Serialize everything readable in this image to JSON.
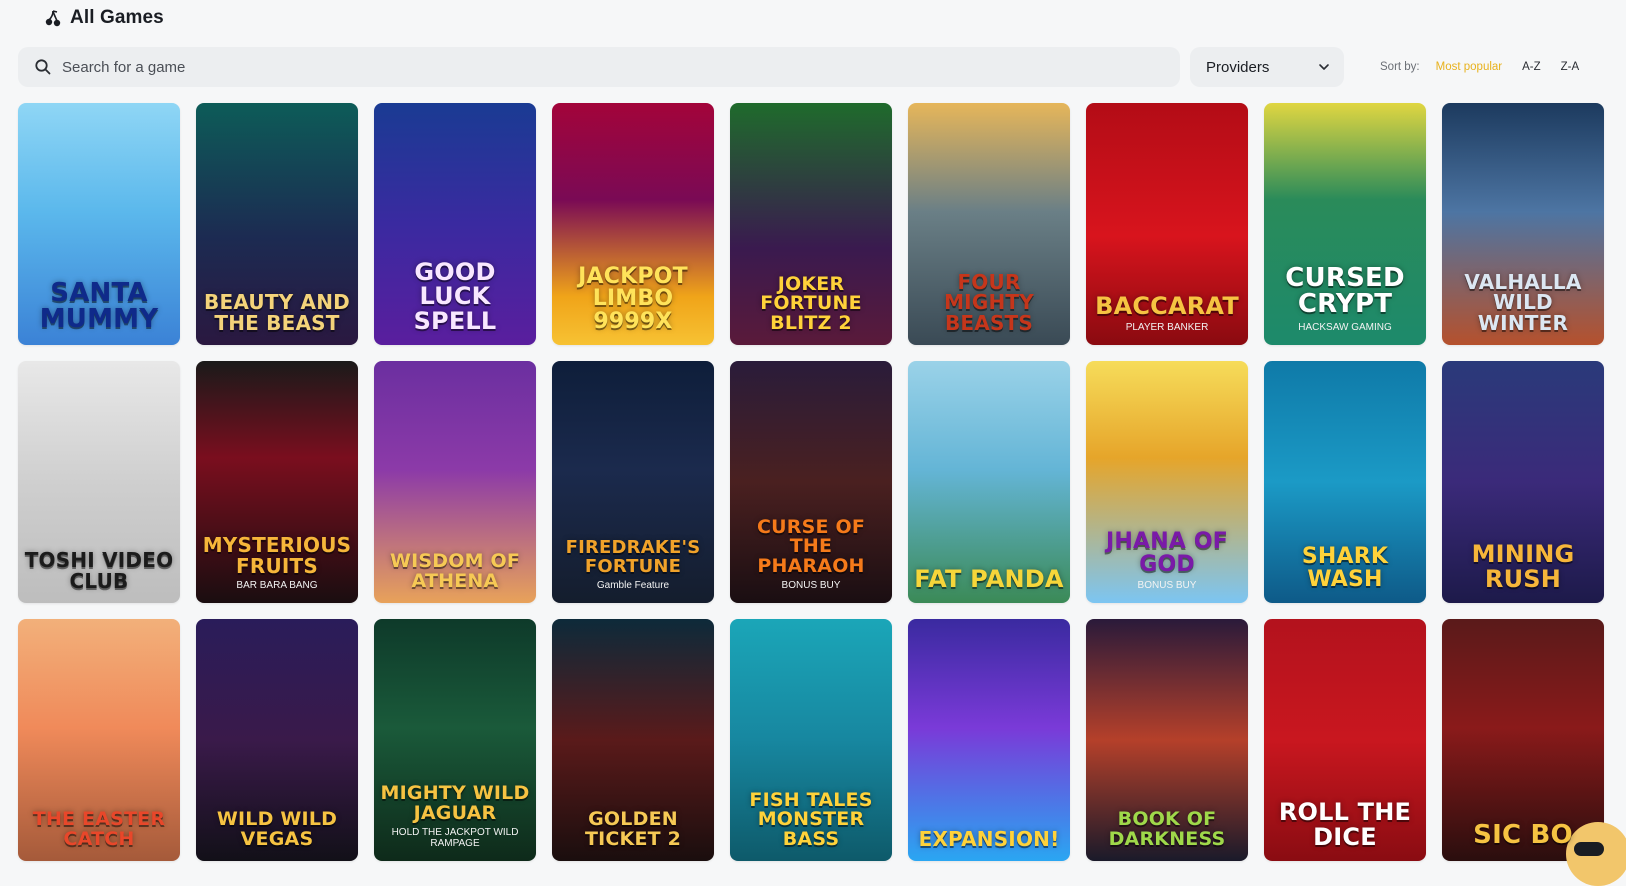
{
  "header": {
    "title": "All Games",
    "icon": "cherries-icon"
  },
  "search": {
    "placeholder": "Search for a game",
    "icon": "search-icon"
  },
  "providers": {
    "label": "Providers",
    "icon": "chevron-down-icon"
  },
  "sort": {
    "label": "Sort by:",
    "options": [
      "Most popular",
      "A-Z",
      "Z-A"
    ],
    "active": "Most popular",
    "accent": "#e8b21e"
  },
  "games": [
    {
      "title": "SANTA MUMMY",
      "sub": "",
      "bg": "linear-gradient(180deg,#8fd6f5 0%,#5bb8ec 45%,#3b82d6 100%)",
      "fg": "#0f2a8a",
      "size": 26
    },
    {
      "title": "Beauty and the Beast",
      "sub": "",
      "bg": "linear-gradient(180deg,#0d5c58 0%,#1c2b52 55%,#2a1840 100%)",
      "fg": "#f4d37a",
      "size": 20
    },
    {
      "title": "GOOD LUCK SPELL",
      "sub": "",
      "bg": "linear-gradient(180deg,#1a3b93 0%,#3a2aa0 50%,#5a1e9e 100%)",
      "fg": "#f8e7ff",
      "size": 24
    },
    {
      "title": "JACKPOT LIMBO 9999x",
      "sub": "",
      "bg": "linear-gradient(180deg,#a3043a 0%,#7a0a55 40%,#f0a419 80%,#f7c233 100%)",
      "fg": "#ffe35a",
      "size": 22
    },
    {
      "title": "JOKER FORTUNE BLITZ 2",
      "sub": "",
      "bg": "linear-gradient(180deg,#1f6b2c 0%,#3a1a4f 60%,#5a1a3a 100%)",
      "fg": "#ffd23a",
      "size": 19
    },
    {
      "title": "FOUR MIGHTY BEASTS",
      "sub": "",
      "bg": "linear-gradient(180deg,#e6b65a 0%,#6a7f86 45%,#3a4a55 100%)",
      "fg": "#c5361b",
      "size": 20
    },
    {
      "title": "BACCARAT",
      "sub": "PLAYER BANKER",
      "bg": "linear-gradient(180deg,#b30c16 0%,#d8141d 55%,#8a0a10 100%)",
      "fg": "#f6c342",
      "size": 24
    },
    {
      "title": "CURSED CRYPT",
      "sub": "HACKSAW GAMING",
      "bg": "linear-gradient(180deg,#e0d641 0%,#2a8b5a 40%,#1d8a6b 100%)",
      "fg": "#ffffff",
      "size": 26
    },
    {
      "title": "VALHALLA WILD WINTER",
      "sub": "",
      "bg": "linear-gradient(180deg,#1c3a5e 0%,#4d75a3 45%,#b5512d 100%)",
      "fg": "#dce7f2",
      "size": 20
    },
    {
      "title": "TOSHI VIDEO CLUB",
      "sub": "",
      "bg": "linear-gradient(180deg,#e8e8e8 0%,#cfcfcf 50%,#bdbdbd 100%)",
      "fg": "#1b1b1b",
      "size": 20
    },
    {
      "title": "MYSTERIOUS FRUITS",
      "sub": "BAR BARA BANG",
      "bg": "linear-gradient(180deg,#1a1a1a 0%,#7a0e1e 40%,#1a0d10 100%)",
      "fg": "#f6b63a",
      "size": 20
    },
    {
      "title": "WISDOM OF ATHENA",
      "sub": "",
      "bg": "linear-gradient(180deg,#6b2fa0 0%,#8c3aa8 45%,#e8a25a 100%)",
      "fg": "#f6c955",
      "size": 19
    },
    {
      "title": "FIREDRAKE'S FORTUNE",
      "sub": "Gamble Feature",
      "bg": "linear-gradient(180deg,#0e1e3a 0%,#1b2a4d 45%,#141d2d 100%)",
      "fg": "#f0a22a",
      "size": 18
    },
    {
      "title": "CURSE OF THE PHARAOH",
      "sub": "BONUS BUY",
      "bg": "linear-gradient(180deg,#2a1c3a 0%,#4a2020 50%,#1a0e12 100%)",
      "fg": "#f57a1a",
      "size": 19
    },
    {
      "title": "FAT PANDA",
      "sub": "",
      "bg": "linear-gradient(180deg,#9ad2e8 0%,#64b5d6 45%,#3b8a57 100%)",
      "fg": "#f6d63a",
      "size": 24
    },
    {
      "title": "JHANA OF GOD",
      "sub": "BONUS BUY",
      "bg": "linear-gradient(180deg,#f6dc5a 0%,#e6a52a 40%,#7cc5f2 100%)",
      "fg": "#7a1aa8",
      "size": 22
    },
    {
      "title": "SHARK WASH",
      "sub": "",
      "bg": "linear-gradient(180deg,#0f7aa8 0%,#1b9ac6 50%,#0e5a88 100%)",
      "fg": "#ffd23a",
      "size": 22
    },
    {
      "title": "MINING RUSH",
      "sub": "",
      "bg": "linear-gradient(180deg,#2a3a7a 0%,#3b2a7a 50%,#1d1a4a 100%)",
      "fg": "#f6b63a",
      "size": 24
    },
    {
      "title": "THE EASTER CATCH",
      "sub": "",
      "bg": "linear-gradient(180deg,#f2b07a 0%,#f08a5a 45%,#a55a3a 100%)",
      "fg": "#e8472a",
      "size": 19
    },
    {
      "title": "WILD WILD VEGAS",
      "sub": "",
      "bg": "linear-gradient(180deg,#2a1c5a 0%,#3a1a4a 50%,#121018 100%)",
      "fg": "#f6c342",
      "size": 19
    },
    {
      "title": "MIGHTY WILD JAGUAR",
      "sub": "HOLD THE JACKPOT WILD RAMPAGE",
      "bg": "linear-gradient(180deg,#0e3a2a 0%,#1a5a3a 45%,#0e2a1a 100%)",
      "fg": "#f6c342",
      "size": 19
    },
    {
      "title": "GOLDEN TICKET 2",
      "sub": "",
      "bg": "linear-gradient(180deg,#0d2a3a 0%,#5a1a1a 50%,#1a0e0e 100%)",
      "fg": "#f6c955",
      "size": 19
    },
    {
      "title": "FISH TALES MONSTER BASS",
      "sub": "",
      "bg": "linear-gradient(180deg,#1ba6b8 0%,#1787a0 50%,#0e5a6a 100%)",
      "fg": "#ffd23a",
      "size": 19
    },
    {
      "title": "EXPANSION!",
      "sub": "",
      "bg": "linear-gradient(180deg,#3a2aa0 0%,#7a3ad8 45%,#2aa6f2 100%)",
      "fg": "#ffd23a",
      "size": 20
    },
    {
      "title": "BOOK OF DARKNESS",
      "sub": "",
      "bg": "linear-gradient(180deg,#2a1a3a 0%,#b5402a 50%,#1a1a2a 100%)",
      "fg": "#9fd84a",
      "size": 19
    },
    {
      "title": "ROLL THE DICE",
      "sub": "",
      "bg": "linear-gradient(180deg,#b3121d 0%,#c9171f 50%,#8a0c12 100%)",
      "fg": "#ffffff",
      "size": 24
    },
    {
      "title": "SIC BO",
      "sub": "",
      "bg": "linear-gradient(180deg,#5a1a1a 0%,#8a1a1a 45%,#2a0e0e 100%)",
      "fg": "#f6c342",
      "size": 26
    }
  ]
}
